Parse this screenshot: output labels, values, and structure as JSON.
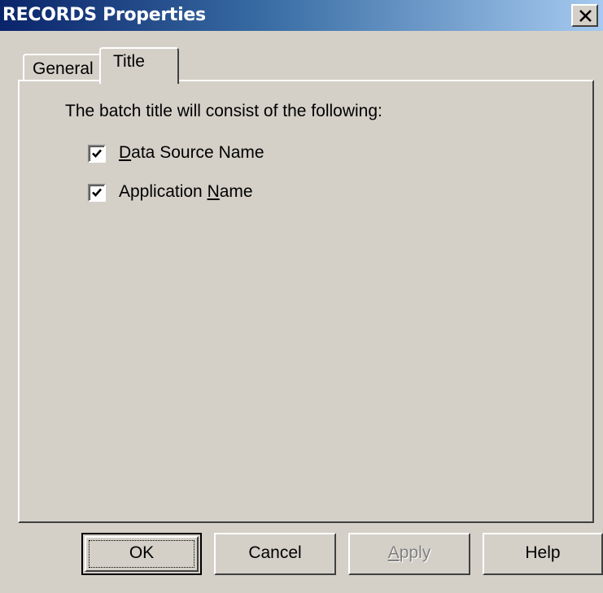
{
  "window": {
    "title": "RECORDS Properties",
    "close_icon": "close-icon",
    "colors": {
      "titlebar_start": "#0a246a",
      "titlebar_end": "#a6caf0",
      "face": "#d4d0c8"
    }
  },
  "tabs": [
    {
      "label": "General",
      "selected": false
    },
    {
      "label": "Title",
      "selected": true
    }
  ],
  "panel": {
    "intro": "The batch title will consist of the following:",
    "options": [
      {
        "label": "Data Source Name",
        "mnemonic": "D",
        "checked": true
      },
      {
        "label": "Application Name",
        "mnemonic": "N",
        "checked": true
      }
    ]
  },
  "buttons": {
    "ok": "OK",
    "cancel": "Cancel",
    "apply": "Apply",
    "help": "Help"
  }
}
